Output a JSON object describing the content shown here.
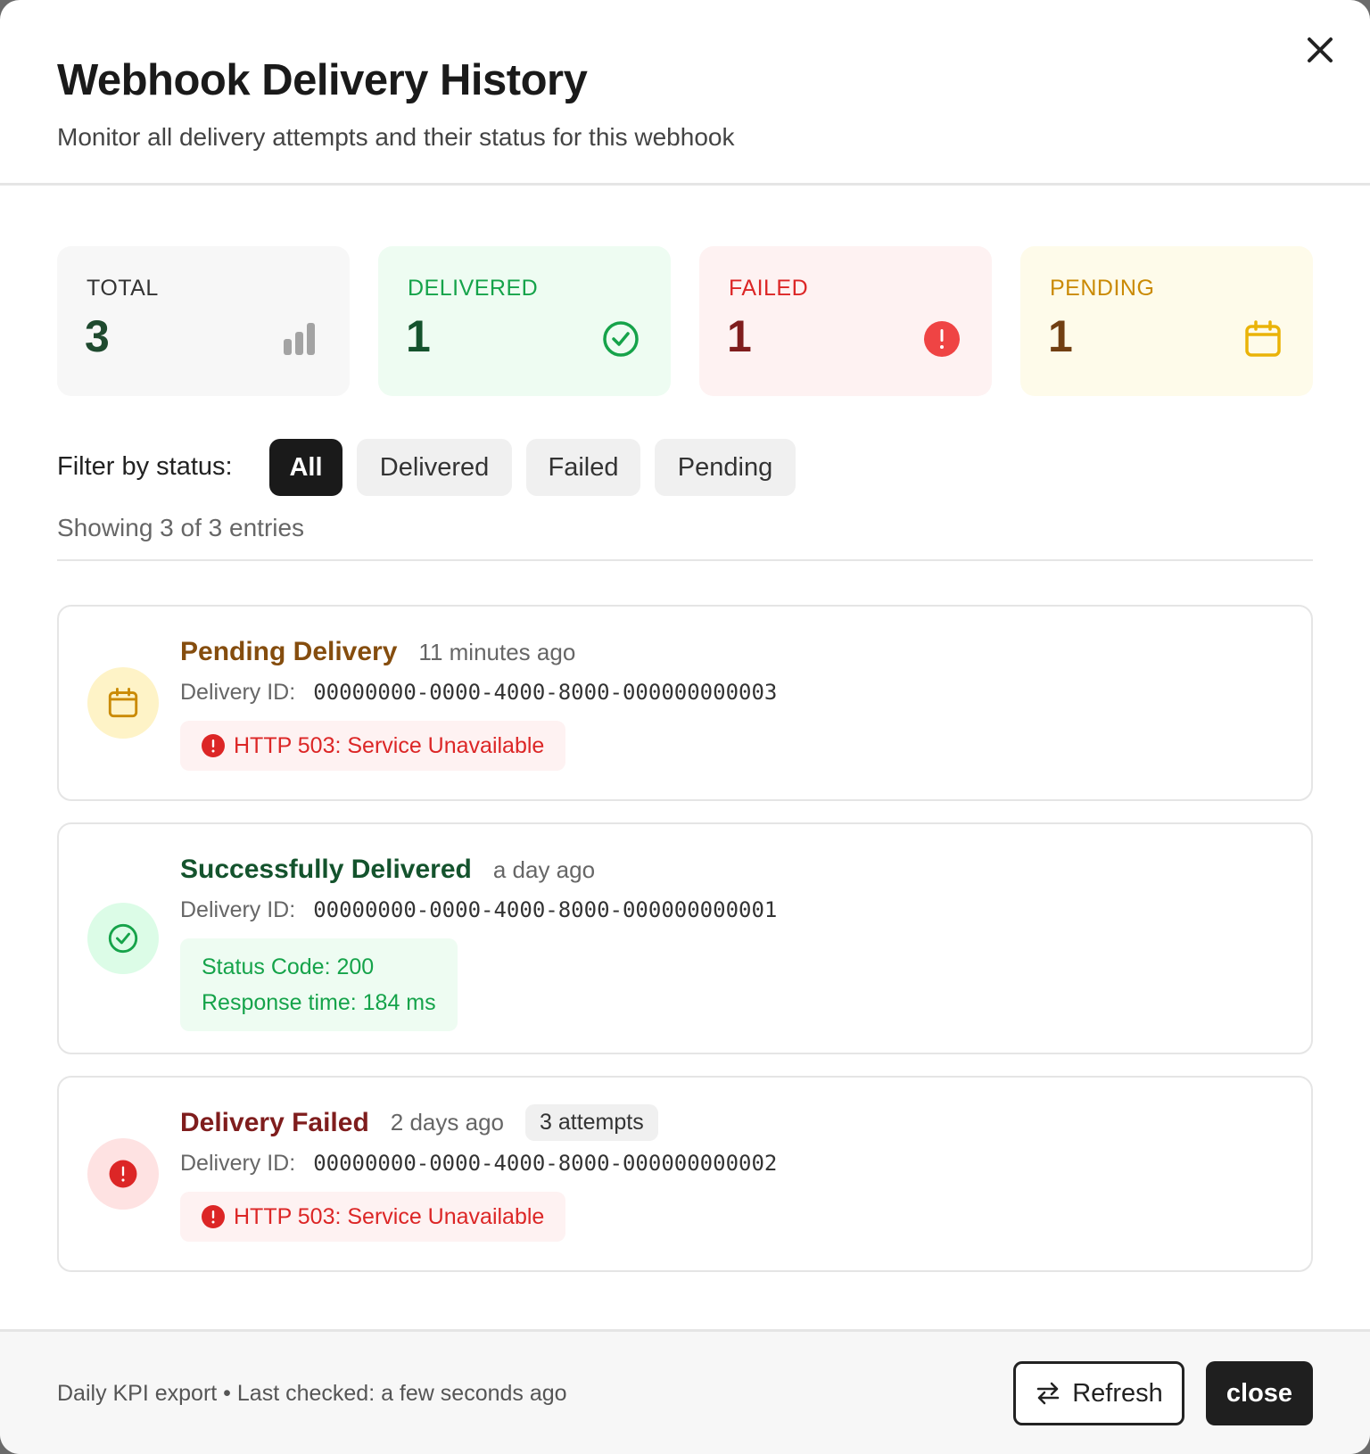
{
  "header": {
    "title": "Webhook Delivery History",
    "subtitle": "Monitor all delivery attempts and their status for this webhook"
  },
  "stats": {
    "total": {
      "label": "TOTAL",
      "value": "3",
      "icon": "bar-chart-icon"
    },
    "delivered": {
      "label": "DELIVERED",
      "value": "1",
      "icon": "check-circle-icon"
    },
    "failed": {
      "label": "FAILED",
      "value": "1",
      "icon": "alert-circle-icon"
    },
    "pending": {
      "label": "PENDING",
      "value": "1",
      "icon": "calendar-icon"
    }
  },
  "filter": {
    "label": "Filter by status:",
    "options": [
      "All",
      "Delivered",
      "Failed",
      "Pending"
    ],
    "selected": "All"
  },
  "showing": "Showing 3 of 3 entries",
  "entries": [
    {
      "status": "pending",
      "title": "Pending Delivery",
      "time": "11 minutes ago",
      "id_label": "Delivery ID:",
      "id": "00000000-0000-4000-8000-000000000003",
      "error": "HTTP 503: Service Unavailable"
    },
    {
      "status": "delivered",
      "title": "Successfully Delivered",
      "time": "a day ago",
      "id_label": "Delivery ID:",
      "id": "00000000-0000-4000-8000-000000000001",
      "status_code": "Status Code: 200",
      "response_time": "Response time: 184 ms"
    },
    {
      "status": "failed",
      "title": "Delivery Failed",
      "time": "2 days ago",
      "attempts": "3 attempts",
      "id_label": "Delivery ID:",
      "id": "00000000-0000-4000-8000-000000000002",
      "error": "HTTP 503: Service Unavailable"
    }
  ],
  "footer": {
    "text": "Daily KPI export • Last checked: a few seconds ago",
    "refresh_label": "Refresh",
    "close_label": "close"
  },
  "colors": {
    "pending_title": "#854d0e",
    "delivered_title": "#14532d",
    "failed_title": "#7f1d1d",
    "error_red": "#dc2626",
    "success_green": "#15a34a",
    "pending_yellow": "#ca8a04"
  }
}
